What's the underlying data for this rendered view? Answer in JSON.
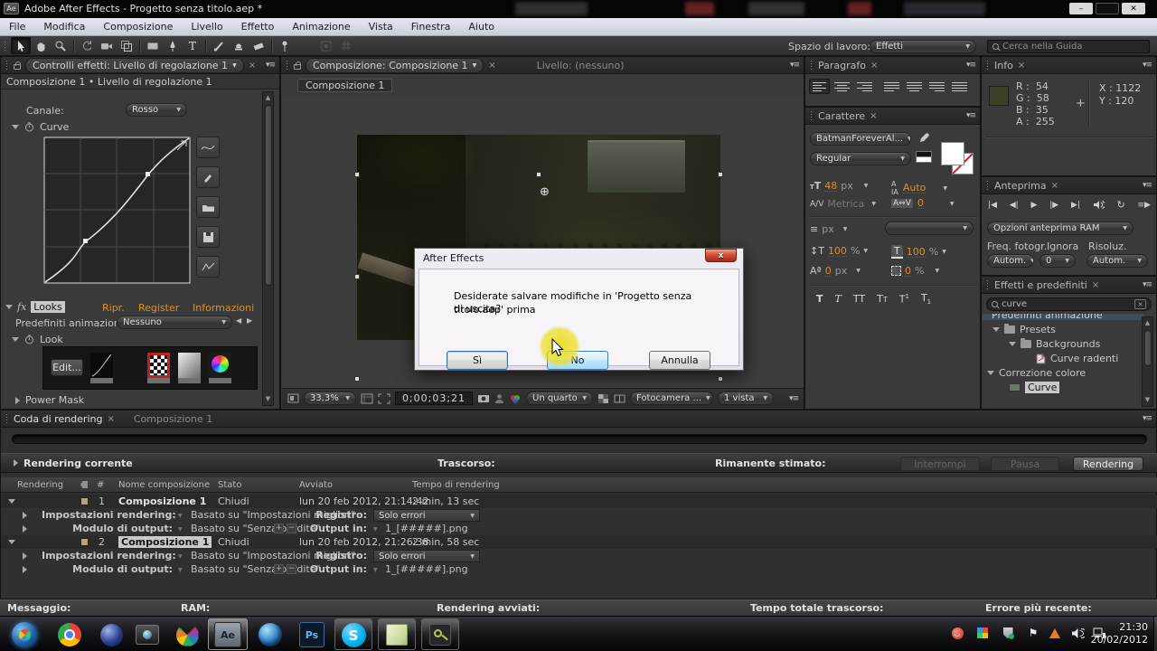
{
  "window": {
    "title": "Adobe After Effects - Progetto senza titolo.aep *",
    "app_badge": "Ae"
  },
  "menu": {
    "items": [
      "File",
      "Modifica",
      "Composizione",
      "Livello",
      "Effetto",
      "Animazione",
      "Vista",
      "Finestra",
      "Aiuto"
    ]
  },
  "toolbar": {
    "workspace_label": "Spazio di lavoro:",
    "workspace_value": "Effetti",
    "search_placeholder": "Cerca nella Guida"
  },
  "effect_controls": {
    "tab_label": "Controlli effetti: Livello di regolazione 1",
    "breadcrumb": "Composizione 1 • Livello di regolazione 1",
    "channel_label": "Canale:",
    "channel_value": "Rosso",
    "curve_label": "Curve",
    "looks_title": "Looks",
    "link_ripr": "Ripr.",
    "link_register": "Register",
    "link_info": "Informazioni",
    "preset_label": "Predefiniti animazion",
    "preset_value": "Nessuno",
    "look_label": "Look",
    "edit_button": "Edit...",
    "power_mask": "Power Mask"
  },
  "composition": {
    "tab_composition": "Composizione: Composizione 1",
    "tab_layer": "Livello: (nessuno)",
    "comp_tab": "Composizione 1",
    "zoom": "33,3%",
    "timecode": "0;00;03;21",
    "resolution": "Un quarto",
    "camera": "Fotocamera ...",
    "view": "1 vista"
  },
  "dialog": {
    "title": "After Effects",
    "message_line1": "Desiderate salvare modifiche in 'Progetto senza titolo.aep' prima",
    "message_line2": "di uscita?",
    "yes": "Sì",
    "no": "No",
    "cancel": "Annulla"
  },
  "paragraph_panel": {
    "title": "Paragrafo"
  },
  "character_panel": {
    "title": "Carattere",
    "font": "BatmanForeverAl...",
    "style": "Regular",
    "size_value": "48",
    "size_unit": "px",
    "kerning_value": "Auto",
    "metrics_value": "Metrica",
    "tracking_value": "0",
    "leading_unit": "px",
    "vscale_value": "100",
    "vscale_unit": "%",
    "hscale_value": "100",
    "hscale_unit": "%",
    "baseline_value": "0",
    "baseline_unit": "px",
    "tsume_value": "0",
    "tsume_unit": "%"
  },
  "info_panel": {
    "title": "Info",
    "channels": [
      {
        "label": "R :",
        "value": "54"
      },
      {
        "label": "G :",
        "value": "58"
      },
      {
        "label": "B :",
        "value": "35"
      },
      {
        "label": "A :",
        "value": "255"
      }
    ],
    "x": "X : 1122",
    "y": "Y : 120",
    "swatch_color": "#3b4027"
  },
  "preview_panel": {
    "title": "Anteprima",
    "ram_options": "Opzioni anteprima RAM",
    "fps_label": "Freq. fotogr.",
    "skip_label": "Ignora",
    "res_label": "Risoluz.",
    "fps_value": "Autom.",
    "skip_value": "0",
    "res_value": "Autom."
  },
  "effects_presets": {
    "title": "Effetti e predefiniti",
    "search_value": "curve",
    "tree": [
      {
        "label": "Predefiniti animazione"
      },
      {
        "label": "Presets"
      },
      {
        "label": "Backgrounds"
      },
      {
        "label": "Curve radenti"
      },
      {
        "label": "Correzione colore"
      },
      {
        "label": "Curve"
      }
    ]
  },
  "render_queue": {
    "tab_queue": "Coda di rendering",
    "tab_comp": "Composizione 1",
    "current_label": "Rendering corrente",
    "elapsed_label": "Trascorso:",
    "remaining_label": "Rimanente stimato:",
    "stop_button": "Interrompi",
    "pause_button": "Pausa",
    "render_button": "Rendering",
    "columns": [
      "Rendering",
      "#",
      "Nome composizione",
      "Stato",
      "Avviato",
      "Tempo di rendering"
    ],
    "items": [
      {
        "num": "1",
        "name": "Composizione 1",
        "status": "Chiudi",
        "started": "lun 20 feb 2012, 21:14:42",
        "render_time": "2 min, 13 sec"
      },
      {
        "num": "2",
        "name": "Composizione 1",
        "status": "Chiudi",
        "started": "lun 20 feb 2012, 21:26:38",
        "render_time": "2 min, 58 sec"
      }
    ],
    "detail": {
      "render_settings_label": "Impostazioni rendering:",
      "render_settings_value": "Basato su \"Impostazioni migliori\"",
      "log_label": "Registro:",
      "log_value": "Solo errori",
      "output_module_label": "Modulo di output:",
      "output_module_value": "Basato su \"Senza perdite\"",
      "output_to_label": "Output in:",
      "output_to_value": "1_[#####].png"
    }
  },
  "status_bar": {
    "message": "Messaggio:",
    "ram": "RAM:",
    "renders_started": "Rendering avviati:",
    "total_elapsed": "Tempo totale trascorso:",
    "last_error": "Errore più recente:"
  },
  "taskbar": {
    "time": "21:30",
    "date": "20/02/2012",
    "ae_badge": "Ae",
    "ps_badge": "Ps",
    "skype_badge": "S"
  },
  "icons": {
    "dropdown_arrow": "▼",
    "panel_menu": "▾≡",
    "close": "×",
    "left_nudge": "◀",
    "right_nudge": "▶",
    "first_frame": "|◀",
    "prev_frame": "◀|",
    "play": "▶",
    "next_frame": "|▶",
    "last_frame": "▶|",
    "loop": "↻",
    "ram_preview": "≡▶",
    "anchor": "⊕",
    "plus": "+",
    "minus": "−",
    "flag": "⚑",
    "window_min": "–",
    "window_close": "✕",
    "scroll_up": "▲",
    "scroll_down": "▼"
  }
}
